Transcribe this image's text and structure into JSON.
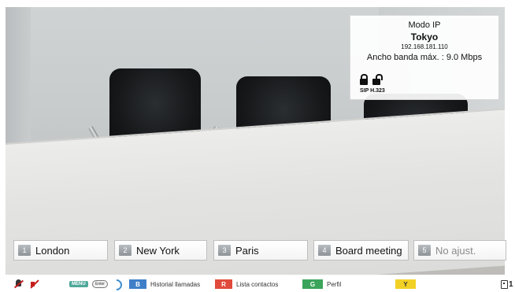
{
  "info_panel": {
    "mode": "Modo IP",
    "site": "Tokyo",
    "ip": "192.168.181.110",
    "bandwidth": "Ancho banda máx. : 9.0 Mbps",
    "protocols": "SIP H.323"
  },
  "speed_dials": [
    {
      "number": "1",
      "label": "London"
    },
    {
      "number": "2",
      "label": "New York"
    },
    {
      "number": "3",
      "label": "Paris"
    },
    {
      "number": "4",
      "label": "Board meeting"
    },
    {
      "number": "5",
      "label": "No ajust."
    }
  ],
  "bottom_bar": {
    "menu_key": "MENU",
    "enter_key": "Enter",
    "blue_key": "B",
    "blue_label": "Historial llamadas",
    "red_key": "R",
    "red_label": "Lista contactos",
    "green_key": "G",
    "green_label": "Perfil",
    "yellow_key": "Y",
    "screen_count": "1"
  },
  "colors": {
    "blue": "#3f7fc8",
    "red": "#e04a3c",
    "green": "#3aa55a",
    "yellow": "#f2d127",
    "menu": "#4fa89a"
  }
}
